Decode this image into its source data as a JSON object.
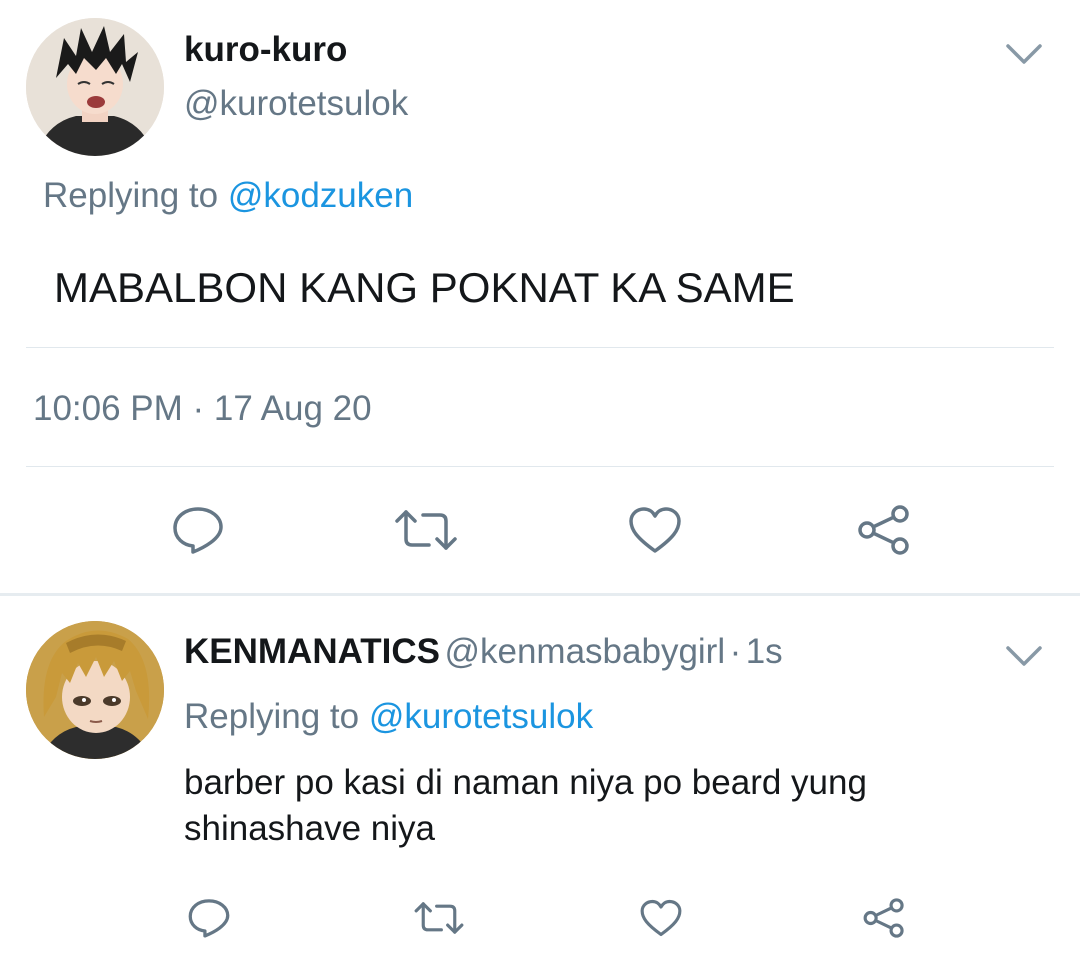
{
  "main_tweet": {
    "display_name": "kuro-kuro",
    "handle": "@kurotetsulok",
    "replying_prefix": "Replying to",
    "replying_to": "@kodzuken",
    "text": "MABALBON KANG POKNAT KA SAME",
    "timestamp": "10:06 PM · 17 Aug 20",
    "actions": [
      "reply-icon",
      "retweet-icon",
      "like-icon",
      "share-icon"
    ]
  },
  "reply_tweet": {
    "display_name": "KENMANATICS",
    "handle": "@kenmasbabygirl",
    "separator": "·",
    "time": "1s",
    "replying_prefix": "Replying to",
    "replying_to": "@kurotetsulok",
    "text": "barber po kasi di naman niya po beard yung shinashave niya",
    "actions": [
      "reply-icon",
      "retweet-icon",
      "like-icon",
      "share-icon"
    ]
  },
  "colors": {
    "primary_text": "#14171a",
    "secondary_text": "#657786",
    "link": "#1b95e0",
    "divider": "#e1e8ed"
  }
}
